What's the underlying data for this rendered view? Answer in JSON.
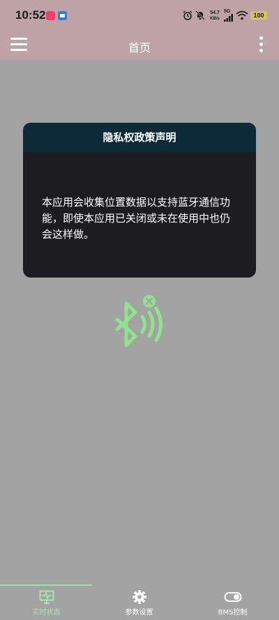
{
  "status_bar": {
    "time": "10:52",
    "net_speed_value": "54.7",
    "net_speed_unit": "KB/s",
    "network_type": "5G",
    "battery": "100",
    "icons": [
      "app-notification-icon",
      "app-notification-icon",
      "alarm-icon",
      "mute-icon",
      "signal-icon",
      "wifi-icon",
      "battery-icon"
    ]
  },
  "app_bar": {
    "title": "首页"
  },
  "dialog": {
    "title": "隐私权政策声明",
    "body": "本应用会收集位置数据以支持蓝牙通信功能，即使本应用已关闭或未在使用中也仍会这样做。"
  },
  "bluetooth": {
    "icon": "bluetooth-disabled-icon",
    "color": "#8fe38f"
  },
  "bottom_nav": {
    "items": [
      {
        "label": "实时状态",
        "icon": "monitor-icon",
        "active": true
      },
      {
        "label": "参数设置",
        "icon": "gear-icon",
        "active": false
      },
      {
        "label": "BMS控制",
        "icon": "toggle-icon",
        "active": false
      }
    ]
  },
  "colors": {
    "app_bar": "#bea3a6",
    "background": "#a3a3a3",
    "dialog_header": "#0d2a38",
    "dialog_body": "#1d1d21",
    "accent": "#a9e7ad"
  }
}
